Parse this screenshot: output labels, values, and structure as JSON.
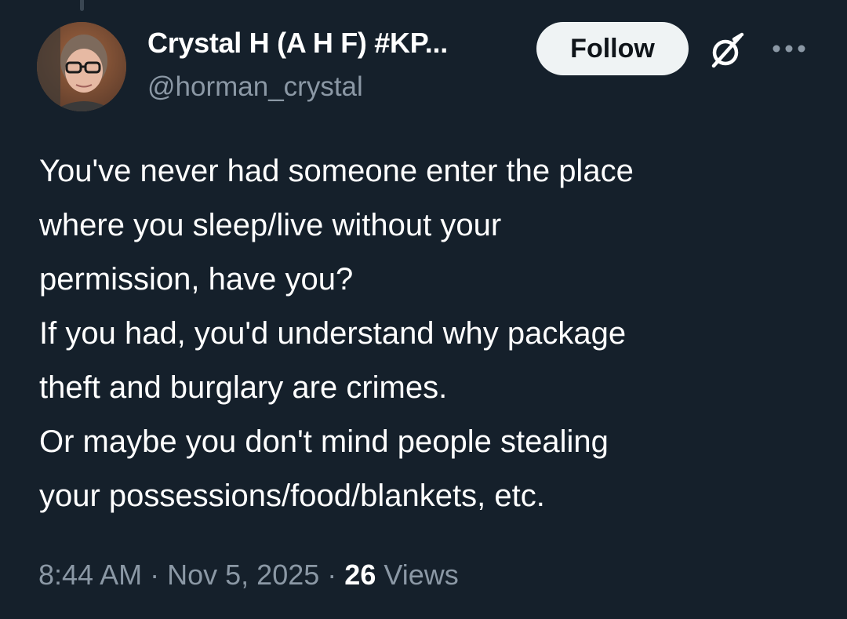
{
  "tweet": {
    "author": {
      "display_name": "Crystal H (A H F) #KP...",
      "handle": "@horman_crystal",
      "avatar_icon": "user-avatar-photo"
    },
    "follow_label": "Follow",
    "text_lines": [
      "You've never had someone enter the place",
      "where you sleep/live without your",
      "permission, have you?",
      "If you had, you'd understand why package",
      "theft and burglary are crimes.",
      "Or maybe you don't mind people stealing",
      "your possessions/food/blankets, etc."
    ],
    "time": "8:44 AM",
    "separator": "·",
    "date": "Nov 5, 2025",
    "views_count": "26",
    "views_label": "Views"
  },
  "icons": {
    "grok": "grok-icon",
    "more": "more-options-icon"
  },
  "colors": {
    "background": "#15202b",
    "text_primary": "#ffffff",
    "text_secondary": "#8b98a5",
    "follow_button_bg": "#eff3f4",
    "follow_button_text": "#0f1419"
  }
}
